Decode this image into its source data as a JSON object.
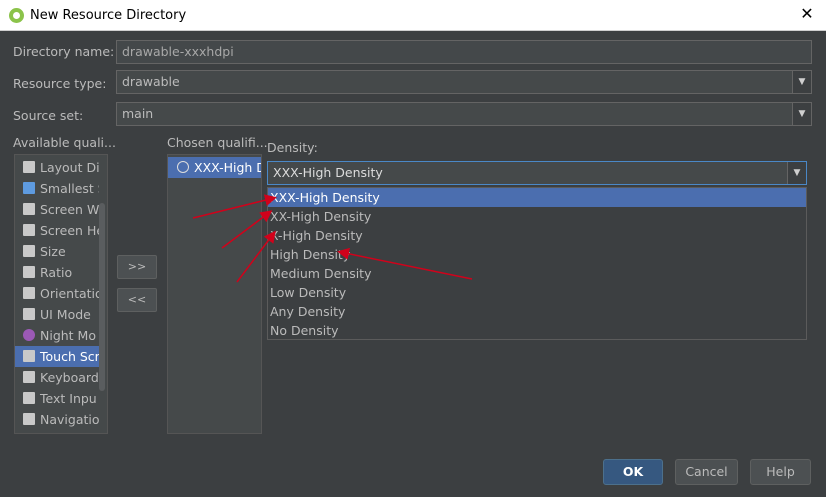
{
  "window": {
    "title": "New Resource Directory"
  },
  "form": {
    "directory_name_label": "Directory name:",
    "directory_name_value": "drawable-xxxhdpi",
    "resource_type_label": "Resource type:",
    "resource_type_value": "drawable",
    "source_set_label": "Source set:",
    "source_set_value": "main"
  },
  "qualifiers": {
    "available_label": "Available quali...",
    "chosen_label": "Chosen qualifi...",
    "available": [
      {
        "label": "Layout Di",
        "icon": "layout-direction-icon"
      },
      {
        "label": "Smallest S",
        "icon": "smallest-screen-width-icon"
      },
      {
        "label": "Screen W",
        "icon": "screen-width-icon"
      },
      {
        "label": "Screen He",
        "icon": "screen-height-icon"
      },
      {
        "label": "Size",
        "icon": "size-icon"
      },
      {
        "label": "Ratio",
        "icon": "ratio-icon"
      },
      {
        "label": "Orientatio",
        "icon": "orientation-icon"
      },
      {
        "label": "UI Mode",
        "icon": "ui-mode-icon"
      },
      {
        "label": "Night Mo",
        "icon": "night-mode-icon"
      },
      {
        "label": "Touch Scr",
        "icon": "touch-screen-icon"
      },
      {
        "label": "Keyboard",
        "icon": "keyboard-icon"
      },
      {
        "label": "Text Inpu",
        "icon": "text-input-icon"
      },
      {
        "label": "Navigatio",
        "icon": "navigation-icon"
      }
    ],
    "selected_available": "Touch Scr",
    "add_button": ">>",
    "remove_button": "<<",
    "chosen": [
      {
        "label": "XXX-High D",
        "icon": "globe-icon"
      }
    ]
  },
  "density": {
    "label": "Density:",
    "value": "XXX-High Density",
    "options": [
      "XXX-High Density",
      "XX-High Density",
      "X-High Density",
      "High Density",
      "Medium Density",
      "Low Density",
      "Any Density",
      "No Density"
    ],
    "selected": "XXX-High Density"
  },
  "annotation_color": "#d0021b",
  "buttons": {
    "ok": "OK",
    "cancel": "Cancel",
    "help": "Help"
  }
}
